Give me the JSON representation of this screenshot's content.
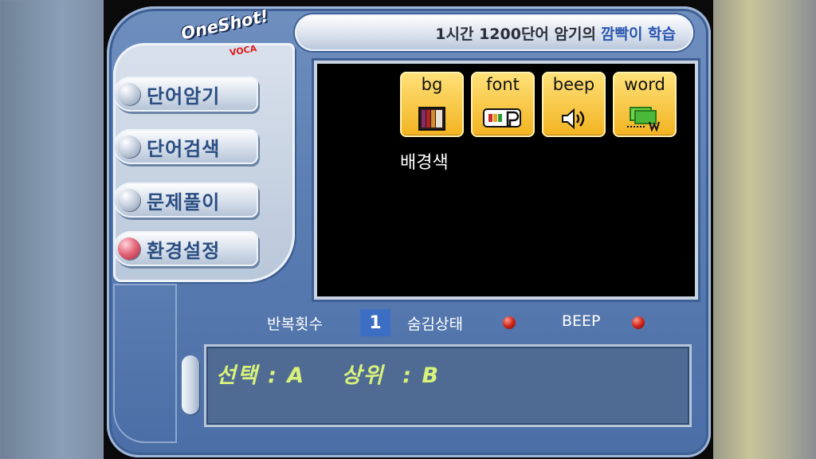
{
  "app": {
    "logo_text": "OneShot!",
    "logo_sub": "VOCA"
  },
  "header": {
    "title_main": "1시간 1200단어 암기의",
    "title_highlight": "깜빡이 학습"
  },
  "menu": {
    "items": [
      {
        "label": "단어암기",
        "active": false
      },
      {
        "label": "단어검색",
        "active": false
      },
      {
        "label": "문제풀이",
        "active": false
      },
      {
        "label": "환경설정",
        "active": true
      }
    ]
  },
  "settings": {
    "options": [
      {
        "label": "bg",
        "icon": "color-bars-icon"
      },
      {
        "label": "font",
        "icon": "font-color-icon"
      },
      {
        "label": "beep",
        "icon": "speaker-icon"
      },
      {
        "label": "word",
        "icon": "word-display-icon"
      }
    ],
    "selected_caption": "배경색"
  },
  "status": {
    "repeat_label": "반복횟수",
    "repeat_value": "1",
    "hidden_label": "숨김상태",
    "beep_label": "BEEP"
  },
  "info": {
    "text": "선택 : A    상위  : B"
  },
  "colors": {
    "shell": "#5a7db2",
    "accent_yellow": "#f2b21f",
    "led_red": "#d1261a",
    "info_text": "#d8f27a"
  }
}
